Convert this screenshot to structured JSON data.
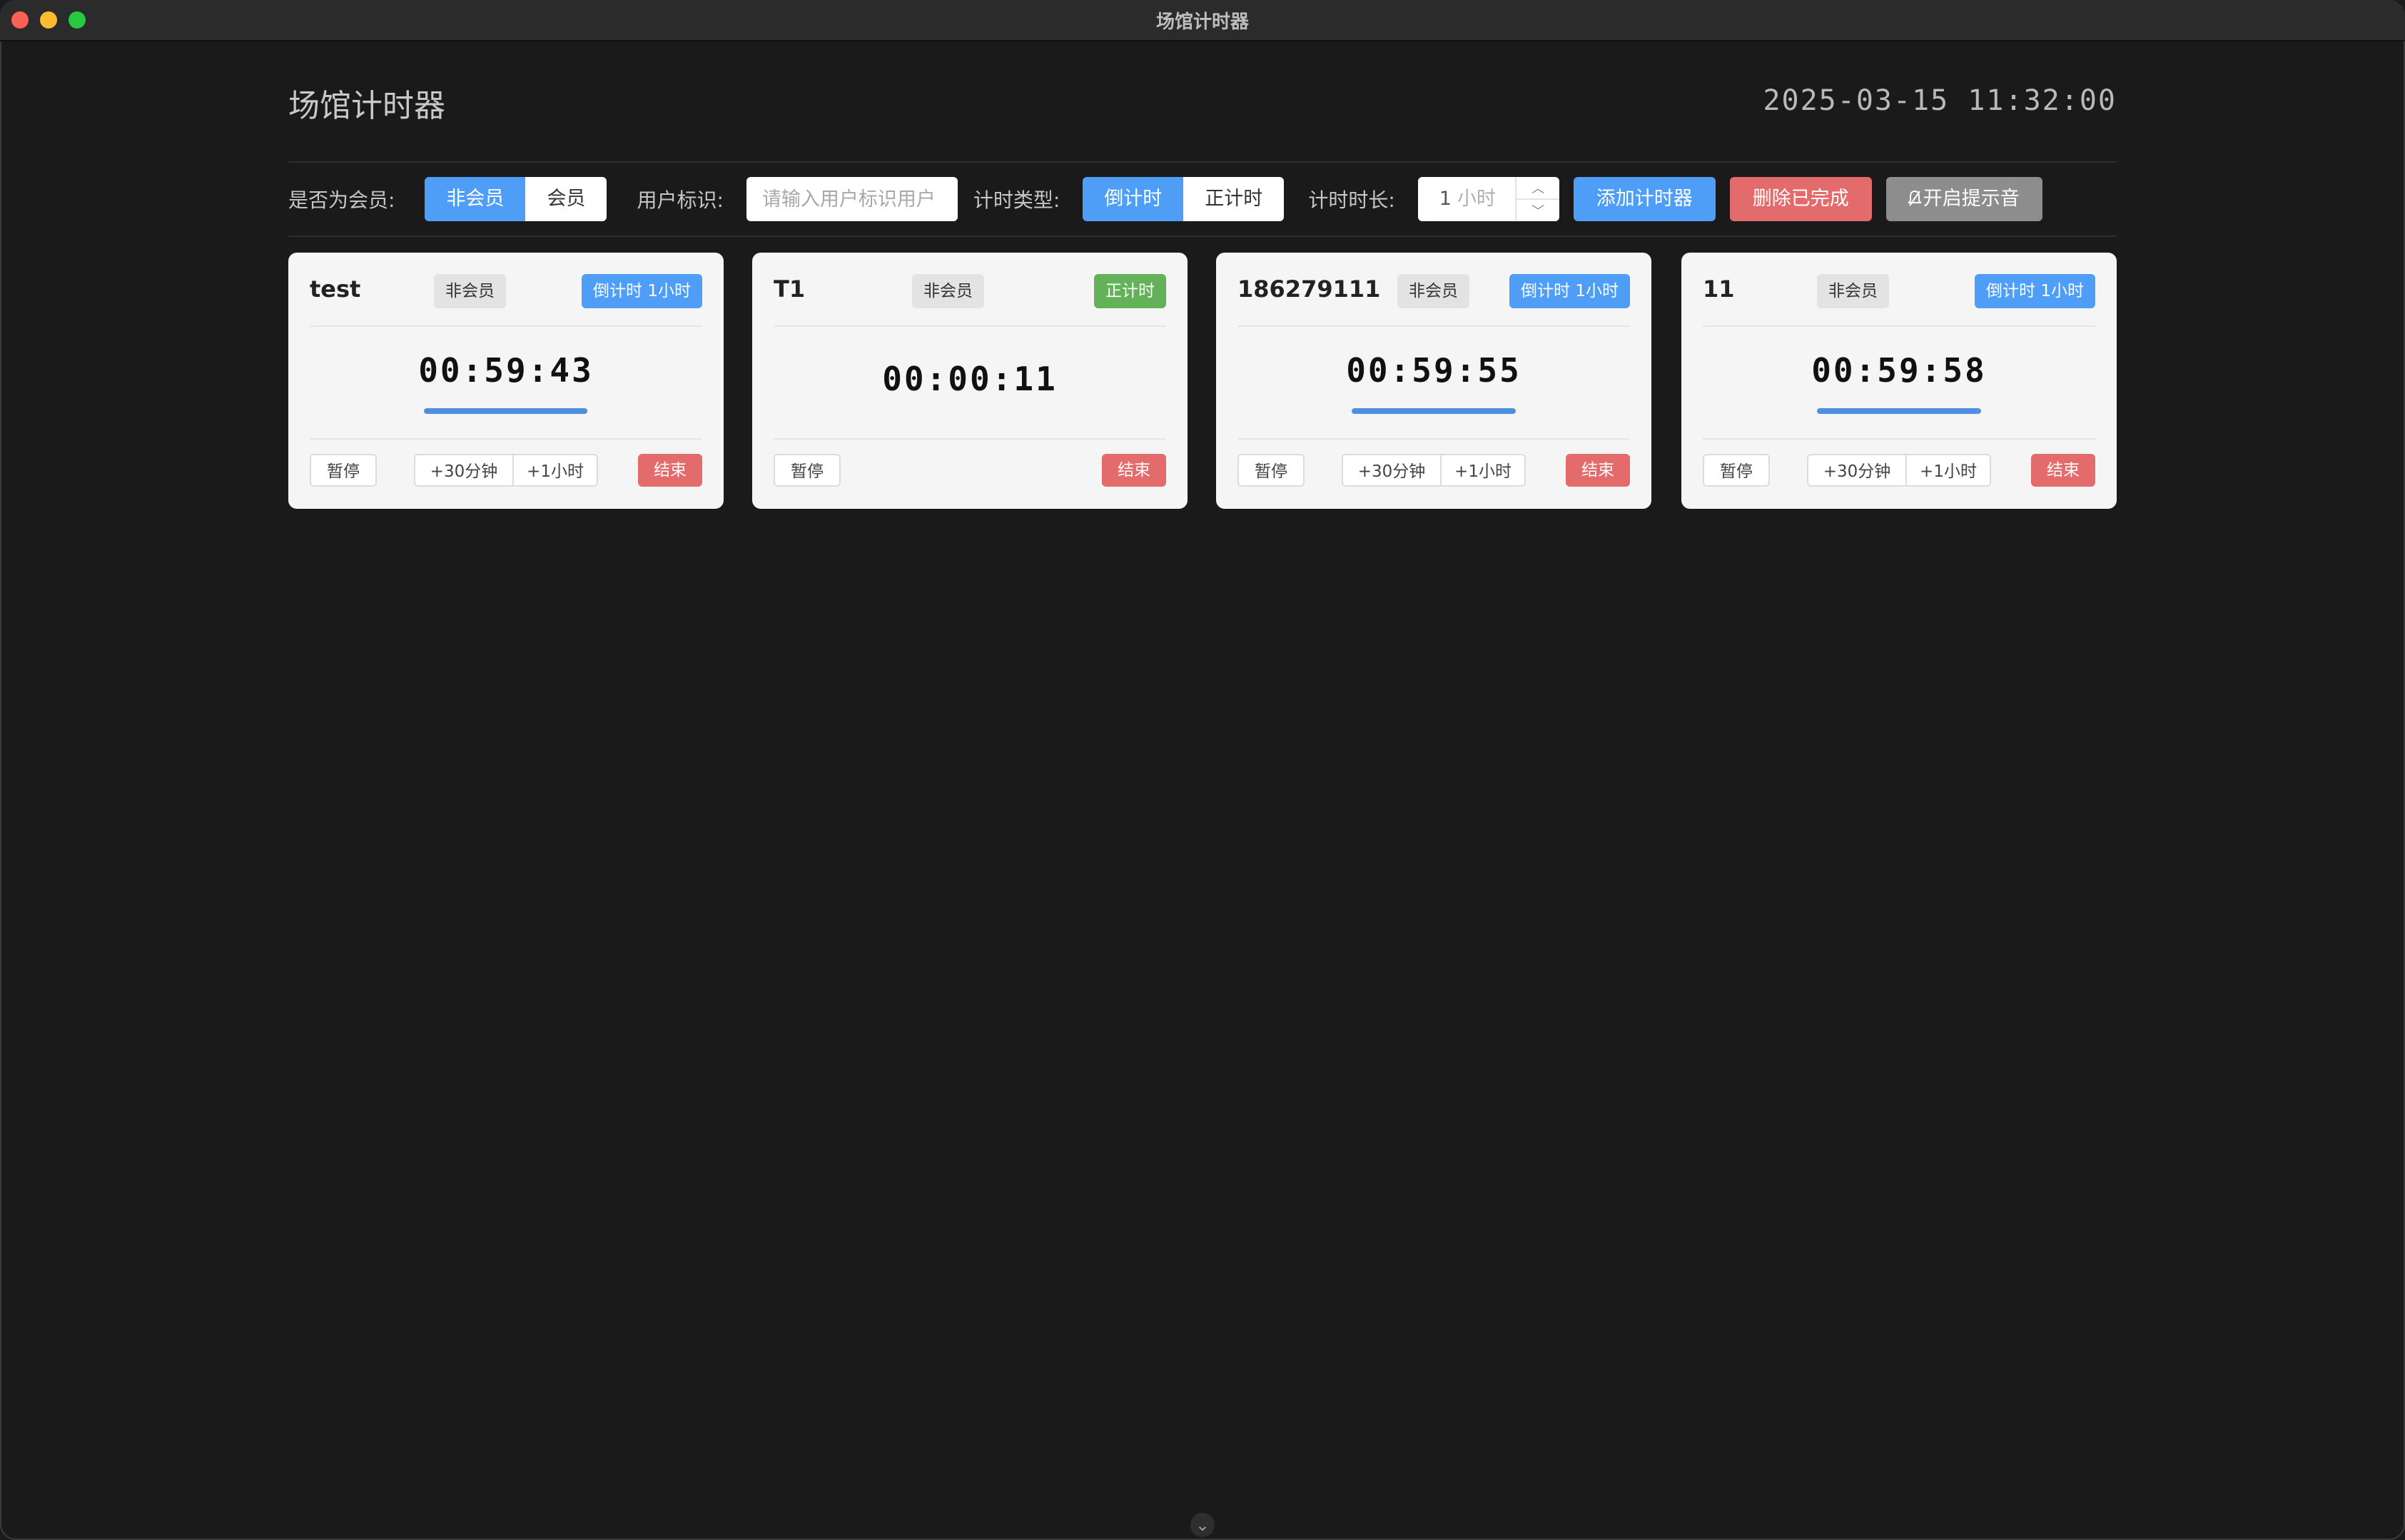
{
  "window": {
    "title": "场馆计时器"
  },
  "header": {
    "title": "场馆计时器",
    "datetime": "2025-03-15 11:32:00"
  },
  "toolbar": {
    "member_label": "是否为会员:",
    "member_options": [
      "非会员",
      "会员"
    ],
    "member_selected": "非会员",
    "user_label": "用户标识:",
    "user_placeholder": "请输入用户标识用户",
    "type_label": "计时类型:",
    "type_options": [
      "倒计时",
      "正计时"
    ],
    "type_selected": "倒计时",
    "duration_label": "计时时长:",
    "duration_value": "1",
    "duration_unit": "小时",
    "add_label": "添加计时器",
    "delete_label": "删除已完成",
    "sound_label": "开启提示音",
    "sound_icon": "bell-off-icon"
  },
  "cards": [
    {
      "name": "test",
      "member": "非会员",
      "type": "倒计时 1小时",
      "time": "00:59:43",
      "progress": 0.995,
      "pause": "暂停",
      "add30": "+30分钟",
      "add1h": "+1小时",
      "end": "结束"
    },
    {
      "name": "T1",
      "member": "非会员",
      "type": "正计时",
      "time": "00:00:11",
      "pause": "暂停",
      "end": "结束"
    },
    {
      "name": "186279111",
      "member": "非会员",
      "type": "倒计时 1小时",
      "time": "00:59:55",
      "progress": 0.999,
      "pause": "暂停",
      "add30": "+30分钟",
      "add1h": "+1小时",
      "end": "结束"
    },
    {
      "name": "11",
      "member": "非会员",
      "type": "倒计时 1小时",
      "time": "00:59:58",
      "progress": 0.999,
      "pause": "暂停",
      "add30": "+30分钟",
      "add1h": "+1小时",
      "end": "结束"
    }
  ],
  "colors": {
    "accent": "#4e9df6",
    "danger": "#e46b6b",
    "success": "#63b25a",
    "muted": "#8d8d8d"
  },
  "footer": {
    "handle_icon": "chevron-down-icon"
  }
}
